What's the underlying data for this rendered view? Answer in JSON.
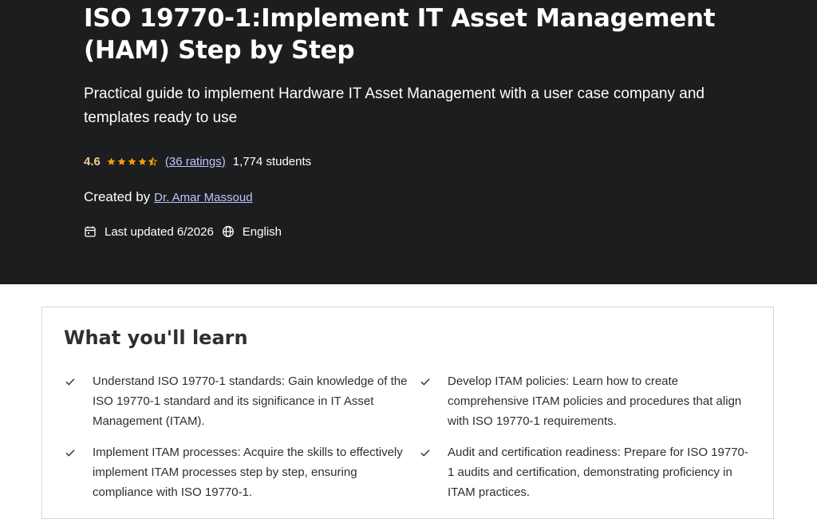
{
  "course": {
    "title": "ISO 19770-1:Implement IT Asset Management (HAM) Step by Step",
    "subtitle": "Practical guide to implement Hardware IT Asset Management with a user case company and templates ready to use",
    "rating": "4.6",
    "rating_stars": 4.5,
    "ratings_count": "(36 ratings)",
    "students": "1,774 students",
    "created_by_label": "Created by",
    "instructor": "Dr. Amar Massoud",
    "last_updated": "Last updated 6/2026",
    "language": "English"
  },
  "colors": {
    "hero_bg": "#1c1d1f",
    "star": "#f69c08",
    "rating_text": "#f3ca8c",
    "link": "#c0c4fc"
  },
  "learn": {
    "heading": "What you'll learn",
    "items": [
      "Understand ISO 19770-1 standards: Gain knowledge of the ISO 19770-1 standard and its significance in IT Asset Management (ITAM).",
      "Develop ITAM policies: Learn how to create comprehensive ITAM policies and procedures that align with ISO 19770-1 requirements.",
      "Implement ITAM processes: Acquire the skills to effectively implement ITAM processes step by step, ensuring compliance with ISO 19770-1.",
      "Audit and certification readiness: Prepare for ISO 19770-1 audits and certification, demonstrating proficiency in ITAM practices."
    ]
  },
  "icons": {
    "calendar": "calendar-icon",
    "globe": "globe-icon",
    "check": "check-icon",
    "star": "star-icon"
  }
}
